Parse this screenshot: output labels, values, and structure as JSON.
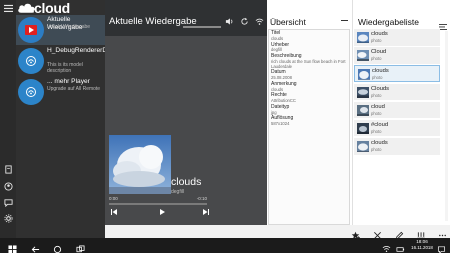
{
  "app": {
    "logo_text": "cloud"
  },
  "sources": [
    {
      "title": "Aktuelle Wiedergabe",
      "subtitle": "Lokale Wiedergabe"
    },
    {
      "title": "H_DebugRendererDevice",
      "subtitle": "This is its model description"
    },
    {
      "title": "... mehr Player",
      "subtitle": "Upgrade auf All Remote"
    }
  ],
  "now_playing": {
    "header_title": "Aktuelle Wiedergabe",
    "track_title": "clouds",
    "track_artist": "degfill",
    "time_elapsed": "0:00",
    "time_remaining": "-0:10",
    "progress": 0
  },
  "overview": {
    "title": "Übersicht",
    "fields": [
      {
        "label": "Titel",
        "value": "clouds"
      },
      {
        "label": "Urheber",
        "value": "degfill"
      },
      {
        "label": "Beschreibung",
        "value": "rich clouds at the Sun flow beach in Fort Lauderdale"
      },
      {
        "label": "Datum",
        "value": "25.08.2008"
      },
      {
        "label": "Anmerkung",
        "value": "clouds"
      },
      {
        "label": "Rechte",
        "value": "AttributionCC"
      },
      {
        "label": "Dateityp",
        "value": "jpg"
      },
      {
        "label": "Auflösung",
        "value": "587x1024"
      }
    ]
  },
  "playlist": {
    "title": "Wiedergabeliste",
    "items": [
      {
        "name": "clouds",
        "kind": "photo"
      },
      {
        "name": "Cloud",
        "kind": "photo"
      },
      {
        "name": "clouds",
        "kind": "photo",
        "selected": true
      },
      {
        "name": "Clouds",
        "kind": "photo"
      },
      {
        "name": "cloud",
        "kind": "photo"
      },
      {
        "name": "#cloud",
        "kind": "photo"
      },
      {
        "name": "clouds",
        "kind": "photo"
      }
    ]
  },
  "taskbar": {
    "time": "18:06",
    "date": "16.11.2018"
  },
  "colors": {
    "accent": "#2c84c9",
    "dark": "#303030",
    "now_playing_bg": "#48494b"
  }
}
